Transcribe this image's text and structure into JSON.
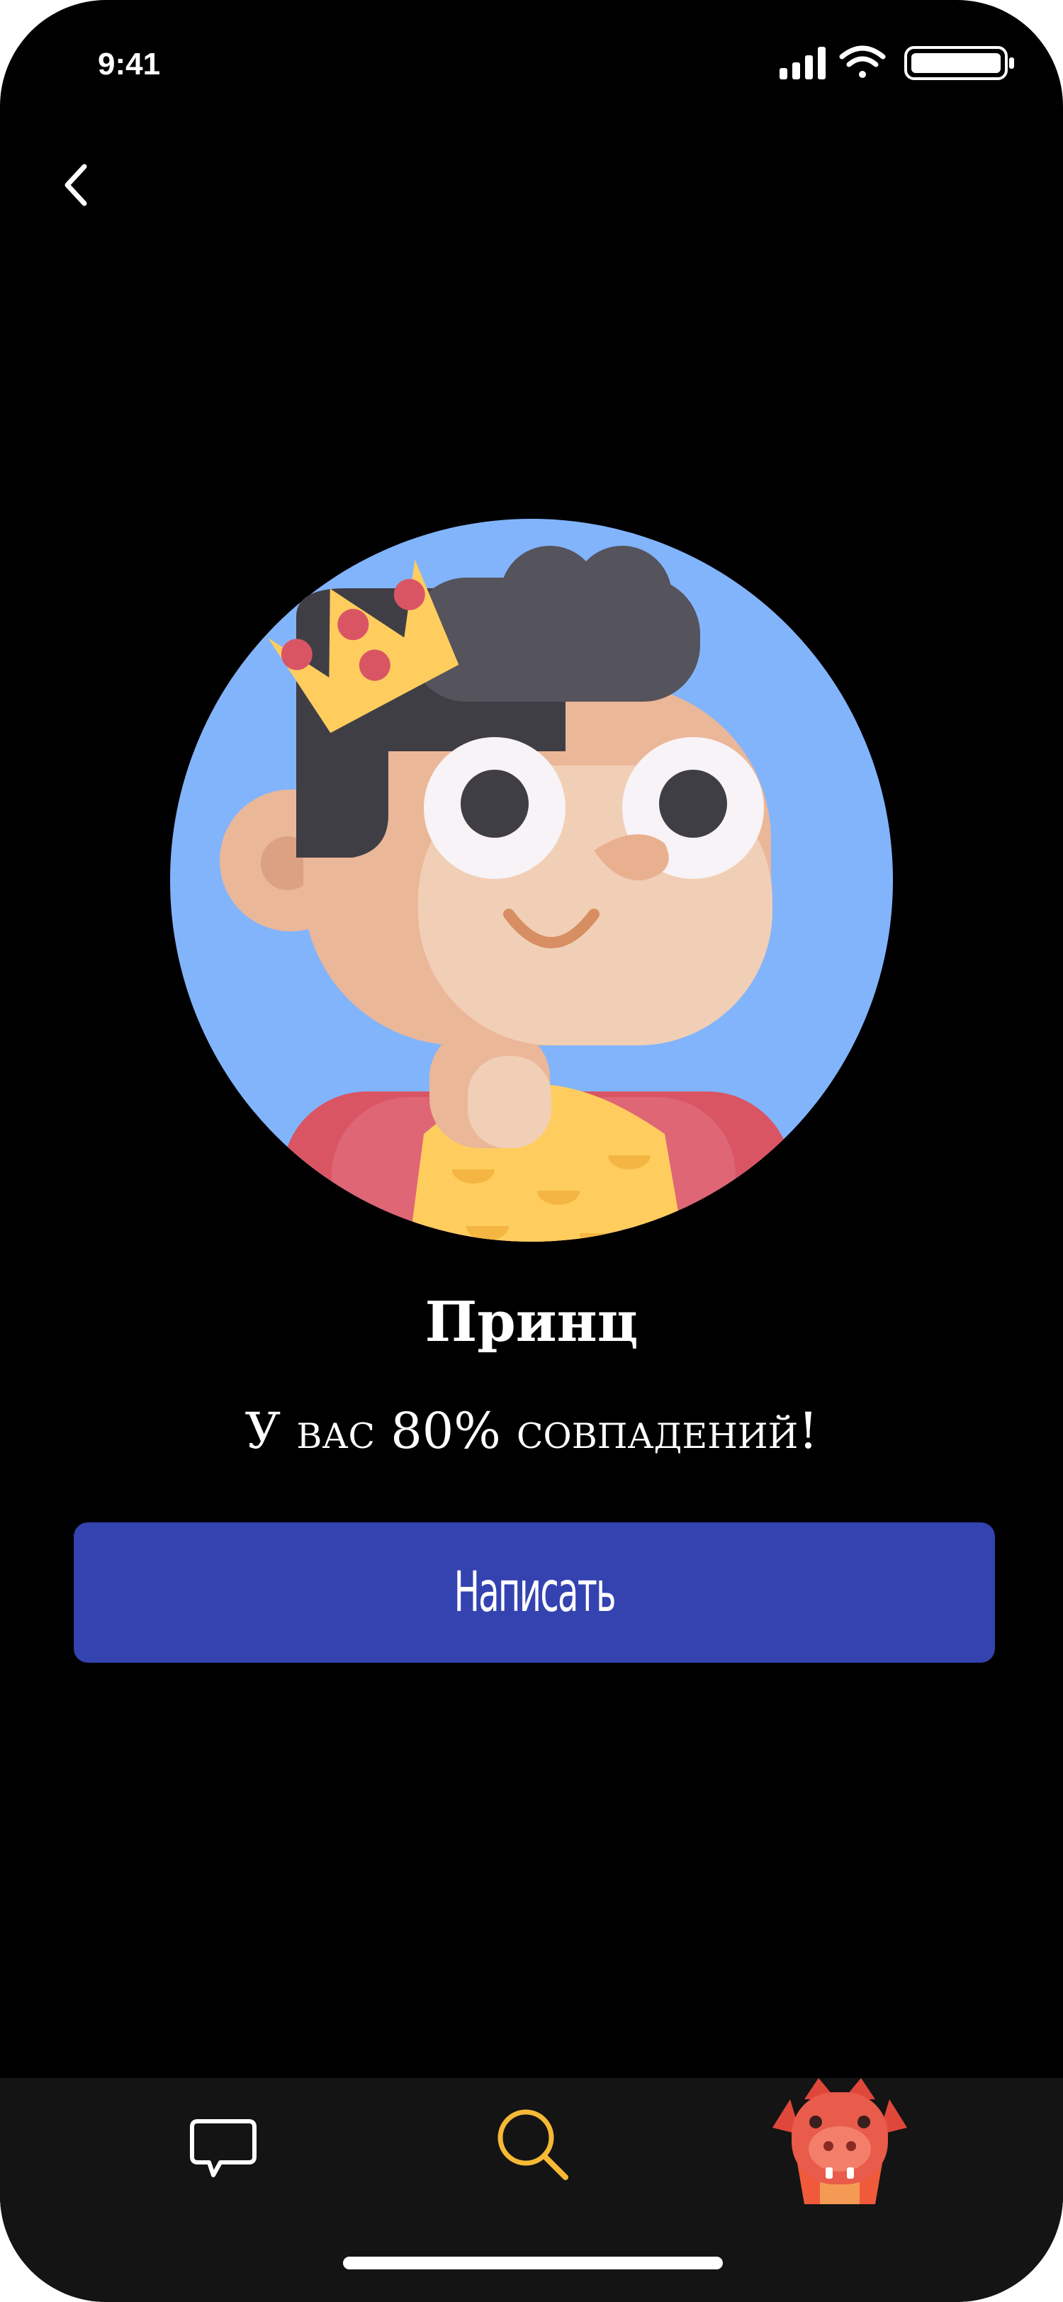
{
  "status_bar": {
    "time": "9:41",
    "icons": [
      "cellular-signal-icon",
      "wifi-icon",
      "battery-icon"
    ]
  },
  "header": {
    "back_icon": "chevron-left-icon"
  },
  "profile": {
    "avatar": "prince-avatar-illustration",
    "name": "Принц",
    "match_text": "У вас 80% совпадений!"
  },
  "actions": {
    "write_label": "Написать"
  },
  "tabbar": {
    "items": [
      {
        "icon": "chat-bubble-icon"
      },
      {
        "icon": "search-icon"
      },
      {
        "icon": "dragon-avatar-icon"
      }
    ]
  },
  "colors": {
    "background": "#000000",
    "button": "#3443B0",
    "tabbar": "#141414",
    "search_accent": "#F5B935",
    "avatar_bg": "#82B4FB"
  }
}
